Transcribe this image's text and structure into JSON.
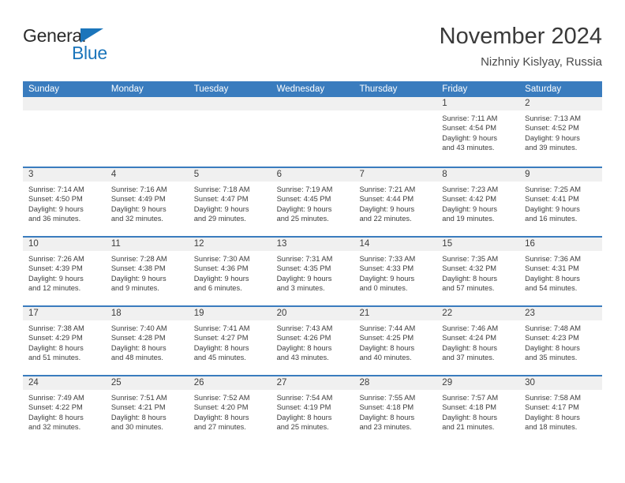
{
  "brand": {
    "name_part1": "General",
    "name_part2": "Blue",
    "accent_color": "#1b75bb"
  },
  "header": {
    "title": "November 2024",
    "subtitle": "Nizhniy Kislyay, Russia"
  },
  "theme": {
    "header_row_bg": "#3a7cbe",
    "day_band_bg": "#f0f0f0",
    "text_color": "#3d3d3d"
  },
  "calendar": {
    "weekday_headers": [
      "Sunday",
      "Monday",
      "Tuesday",
      "Wednesday",
      "Thursday",
      "Friday",
      "Saturday"
    ],
    "weeks": [
      [
        {
          "empty": true
        },
        {
          "empty": true
        },
        {
          "empty": true
        },
        {
          "empty": true
        },
        {
          "empty": true
        },
        {
          "day": "1",
          "sunrise": "Sunrise: 7:11 AM",
          "sunset": "Sunset: 4:54 PM",
          "daylight_line1": "Daylight: 9 hours",
          "daylight_line2": "and 43 minutes."
        },
        {
          "day": "2",
          "sunrise": "Sunrise: 7:13 AM",
          "sunset": "Sunset: 4:52 PM",
          "daylight_line1": "Daylight: 9 hours",
          "daylight_line2": "and 39 minutes."
        }
      ],
      [
        {
          "day": "3",
          "sunrise": "Sunrise: 7:14 AM",
          "sunset": "Sunset: 4:50 PM",
          "daylight_line1": "Daylight: 9 hours",
          "daylight_line2": "and 36 minutes."
        },
        {
          "day": "4",
          "sunrise": "Sunrise: 7:16 AM",
          "sunset": "Sunset: 4:49 PM",
          "daylight_line1": "Daylight: 9 hours",
          "daylight_line2": "and 32 minutes."
        },
        {
          "day": "5",
          "sunrise": "Sunrise: 7:18 AM",
          "sunset": "Sunset: 4:47 PM",
          "daylight_line1": "Daylight: 9 hours",
          "daylight_line2": "and 29 minutes."
        },
        {
          "day": "6",
          "sunrise": "Sunrise: 7:19 AM",
          "sunset": "Sunset: 4:45 PM",
          "daylight_line1": "Daylight: 9 hours",
          "daylight_line2": "and 25 minutes."
        },
        {
          "day": "7",
          "sunrise": "Sunrise: 7:21 AM",
          "sunset": "Sunset: 4:44 PM",
          "daylight_line1": "Daylight: 9 hours",
          "daylight_line2": "and 22 minutes."
        },
        {
          "day": "8",
          "sunrise": "Sunrise: 7:23 AM",
          "sunset": "Sunset: 4:42 PM",
          "daylight_line1": "Daylight: 9 hours",
          "daylight_line2": "and 19 minutes."
        },
        {
          "day": "9",
          "sunrise": "Sunrise: 7:25 AM",
          "sunset": "Sunset: 4:41 PM",
          "daylight_line1": "Daylight: 9 hours",
          "daylight_line2": "and 16 minutes."
        }
      ],
      [
        {
          "day": "10",
          "sunrise": "Sunrise: 7:26 AM",
          "sunset": "Sunset: 4:39 PM",
          "daylight_line1": "Daylight: 9 hours",
          "daylight_line2": "and 12 minutes."
        },
        {
          "day": "11",
          "sunrise": "Sunrise: 7:28 AM",
          "sunset": "Sunset: 4:38 PM",
          "daylight_line1": "Daylight: 9 hours",
          "daylight_line2": "and 9 minutes."
        },
        {
          "day": "12",
          "sunrise": "Sunrise: 7:30 AM",
          "sunset": "Sunset: 4:36 PM",
          "daylight_line1": "Daylight: 9 hours",
          "daylight_line2": "and 6 minutes."
        },
        {
          "day": "13",
          "sunrise": "Sunrise: 7:31 AM",
          "sunset": "Sunset: 4:35 PM",
          "daylight_line1": "Daylight: 9 hours",
          "daylight_line2": "and 3 minutes."
        },
        {
          "day": "14",
          "sunrise": "Sunrise: 7:33 AM",
          "sunset": "Sunset: 4:33 PM",
          "daylight_line1": "Daylight: 9 hours",
          "daylight_line2": "and 0 minutes."
        },
        {
          "day": "15",
          "sunrise": "Sunrise: 7:35 AM",
          "sunset": "Sunset: 4:32 PM",
          "daylight_line1": "Daylight: 8 hours",
          "daylight_line2": "and 57 minutes."
        },
        {
          "day": "16",
          "sunrise": "Sunrise: 7:36 AM",
          "sunset": "Sunset: 4:31 PM",
          "daylight_line1": "Daylight: 8 hours",
          "daylight_line2": "and 54 minutes."
        }
      ],
      [
        {
          "day": "17",
          "sunrise": "Sunrise: 7:38 AM",
          "sunset": "Sunset: 4:29 PM",
          "daylight_line1": "Daylight: 8 hours",
          "daylight_line2": "and 51 minutes."
        },
        {
          "day": "18",
          "sunrise": "Sunrise: 7:40 AM",
          "sunset": "Sunset: 4:28 PM",
          "daylight_line1": "Daylight: 8 hours",
          "daylight_line2": "and 48 minutes."
        },
        {
          "day": "19",
          "sunrise": "Sunrise: 7:41 AM",
          "sunset": "Sunset: 4:27 PM",
          "daylight_line1": "Daylight: 8 hours",
          "daylight_line2": "and 45 minutes."
        },
        {
          "day": "20",
          "sunrise": "Sunrise: 7:43 AM",
          "sunset": "Sunset: 4:26 PM",
          "daylight_line1": "Daylight: 8 hours",
          "daylight_line2": "and 43 minutes."
        },
        {
          "day": "21",
          "sunrise": "Sunrise: 7:44 AM",
          "sunset": "Sunset: 4:25 PM",
          "daylight_line1": "Daylight: 8 hours",
          "daylight_line2": "and 40 minutes."
        },
        {
          "day": "22",
          "sunrise": "Sunrise: 7:46 AM",
          "sunset": "Sunset: 4:24 PM",
          "daylight_line1": "Daylight: 8 hours",
          "daylight_line2": "and 37 minutes."
        },
        {
          "day": "23",
          "sunrise": "Sunrise: 7:48 AM",
          "sunset": "Sunset: 4:23 PM",
          "daylight_line1": "Daylight: 8 hours",
          "daylight_line2": "and 35 minutes."
        }
      ],
      [
        {
          "day": "24",
          "sunrise": "Sunrise: 7:49 AM",
          "sunset": "Sunset: 4:22 PM",
          "daylight_line1": "Daylight: 8 hours",
          "daylight_line2": "and 32 minutes."
        },
        {
          "day": "25",
          "sunrise": "Sunrise: 7:51 AM",
          "sunset": "Sunset: 4:21 PM",
          "daylight_line1": "Daylight: 8 hours",
          "daylight_line2": "and 30 minutes."
        },
        {
          "day": "26",
          "sunrise": "Sunrise: 7:52 AM",
          "sunset": "Sunset: 4:20 PM",
          "daylight_line1": "Daylight: 8 hours",
          "daylight_line2": "and 27 minutes."
        },
        {
          "day": "27",
          "sunrise": "Sunrise: 7:54 AM",
          "sunset": "Sunset: 4:19 PM",
          "daylight_line1": "Daylight: 8 hours",
          "daylight_line2": "and 25 minutes."
        },
        {
          "day": "28",
          "sunrise": "Sunrise: 7:55 AM",
          "sunset": "Sunset: 4:18 PM",
          "daylight_line1": "Daylight: 8 hours",
          "daylight_line2": "and 23 minutes."
        },
        {
          "day": "29",
          "sunrise": "Sunrise: 7:57 AM",
          "sunset": "Sunset: 4:18 PM",
          "daylight_line1": "Daylight: 8 hours",
          "daylight_line2": "and 21 minutes."
        },
        {
          "day": "30",
          "sunrise": "Sunrise: 7:58 AM",
          "sunset": "Sunset: 4:17 PM",
          "daylight_line1": "Daylight: 8 hours",
          "daylight_line2": "and 18 minutes."
        }
      ]
    ]
  }
}
